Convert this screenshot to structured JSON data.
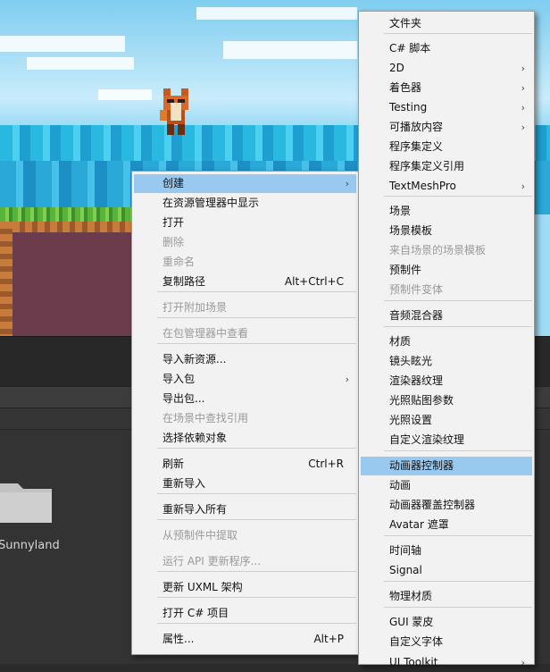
{
  "context_menu": {
    "items": [
      {
        "label": "创建",
        "arrow": "›",
        "disabled": false,
        "highlight": true
      },
      {
        "label": "在资源管理器中显示",
        "disabled": false
      },
      {
        "label": "打开",
        "disabled": false
      },
      {
        "label": "删除",
        "disabled": true
      },
      {
        "label": "重命名",
        "disabled": true
      },
      {
        "label": "复制路径",
        "shortcut": "Alt+Ctrl+C",
        "disabled": false
      },
      {
        "label": "打开附加场景",
        "disabled": true
      },
      {
        "label": "在包管理器中查看",
        "disabled": true
      },
      {
        "label": "导入新资源...",
        "disabled": false
      },
      {
        "label": "导入包",
        "arrow": "›",
        "disabled": false
      },
      {
        "label": "导出包...",
        "disabled": false
      },
      {
        "label": "在场景中查找引用",
        "disabled": true
      },
      {
        "label": "选择依赖对象",
        "disabled": false
      },
      {
        "label": "刷新",
        "shortcut": "Ctrl+R",
        "disabled": false
      },
      {
        "label": "重新导入",
        "disabled": false
      },
      {
        "label": "重新导入所有",
        "disabled": false
      },
      {
        "label": "从预制件中提取",
        "disabled": true
      },
      {
        "label": "运行 API 更新程序...",
        "disabled": true
      },
      {
        "label": "更新 UXML 架构",
        "disabled": false
      },
      {
        "label": "打开 C# 项目",
        "disabled": false
      },
      {
        "label": "属性...",
        "shortcut": "Alt+P",
        "disabled": false
      }
    ]
  },
  "submenu": {
    "items": [
      {
        "label": "文件夹",
        "disabled": false
      },
      {
        "label": "C# 脚本",
        "disabled": false
      },
      {
        "label": "2D",
        "arrow": "›",
        "disabled": false
      },
      {
        "label": "着色器",
        "arrow": "›",
        "disabled": false
      },
      {
        "label": "Testing",
        "arrow": "›",
        "disabled": false
      },
      {
        "label": "可播放内容",
        "arrow": "›",
        "disabled": false
      },
      {
        "label": "程序集定义",
        "disabled": false
      },
      {
        "label": "程序集定义引用",
        "disabled": false
      },
      {
        "label": "TextMeshPro",
        "arrow": "›",
        "disabled": false
      },
      {
        "label": "场景",
        "disabled": false
      },
      {
        "label": "场景模板",
        "disabled": false
      },
      {
        "label": "来自场景的场景模板",
        "disabled": true
      },
      {
        "label": "预制件",
        "disabled": false
      },
      {
        "label": "预制件变体",
        "disabled": true
      },
      {
        "label": "音频混合器",
        "disabled": false
      },
      {
        "label": "材质",
        "disabled": false
      },
      {
        "label": "镜头眩光",
        "disabled": false
      },
      {
        "label": "渲染器纹理",
        "disabled": false
      },
      {
        "label": "光照贴图参数",
        "disabled": false
      },
      {
        "label": "光照设置",
        "disabled": false
      },
      {
        "label": "自定义渲染纹理",
        "disabled": false
      },
      {
        "label": "动画器控制器",
        "disabled": false,
        "highlight": true
      },
      {
        "label": "动画",
        "disabled": false
      },
      {
        "label": "动画器覆盖控制器",
        "disabled": false
      },
      {
        "label": "Avatar 遮罩",
        "disabled": false
      },
      {
        "label": "时间轴",
        "disabled": false
      },
      {
        "label": "Signal",
        "disabled": false
      },
      {
        "label": "物理材质",
        "disabled": false
      },
      {
        "label": "GUI 蒙皮",
        "disabled": false
      },
      {
        "label": "自定义字体",
        "disabled": false
      },
      {
        "label": "UI Toolkit",
        "arrow": "›",
        "disabled": false
      }
    ]
  },
  "project": {
    "folder_label": "Sunnyland"
  },
  "colors": {
    "highlight": "#99c9ef",
    "menu_bg": "#f2f2f2",
    "disabled": "#9a9a9a"
  }
}
